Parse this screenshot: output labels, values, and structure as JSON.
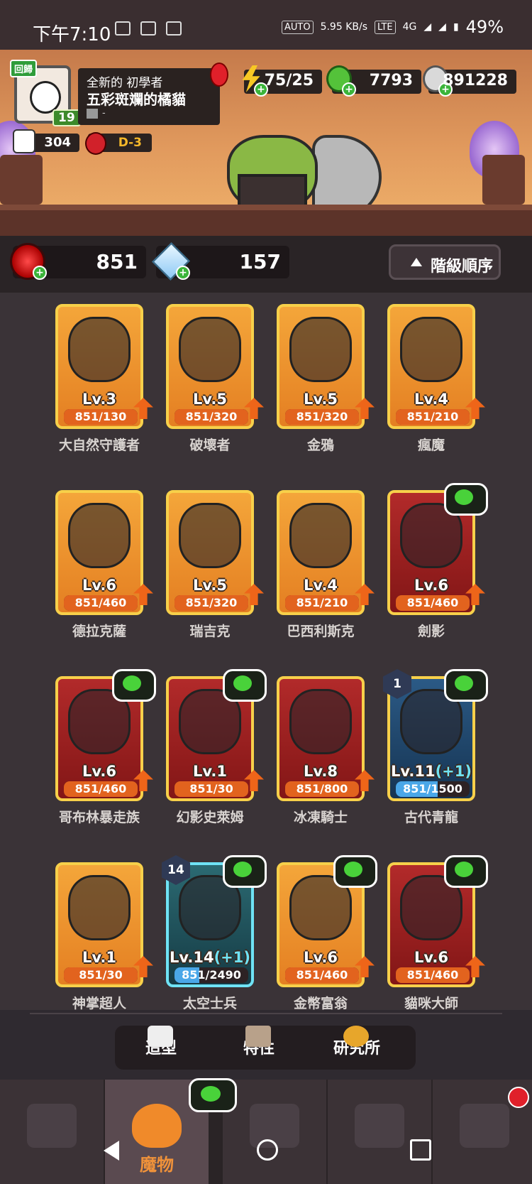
{
  "status_bar": {
    "time": "下午7:10",
    "speed": "5.95\nKB/s",
    "network": "4G",
    "battery": "49%"
  },
  "profile": {
    "return_badge": "回歸",
    "level": "19",
    "rank": "全新的 初學者",
    "name": "五彩斑斕的橘貓",
    "guild": "-",
    "likes": "304",
    "stage": "D-3"
  },
  "resources": {
    "energy": "75/25",
    "gems": "7793",
    "coins": "891228"
  },
  "currencies": {
    "red_orb": "851",
    "crystal": "157"
  },
  "sort_button": "階級順序",
  "monsters": [
    {
      "name": "大自然守護者",
      "level": "Lv.3",
      "level_plus": "",
      "progress": "851/130",
      "fill": 1.0,
      "style": "orange",
      "gem": false,
      "hex": ""
    },
    {
      "name": "破壞者",
      "level": "Lv.5",
      "level_plus": "",
      "progress": "851/320",
      "fill": 1.0,
      "style": "orange",
      "gem": false,
      "hex": ""
    },
    {
      "name": "金鴉",
      "level": "Lv.5",
      "level_plus": "",
      "progress": "851/320",
      "fill": 1.0,
      "style": "orange",
      "gem": false,
      "hex": ""
    },
    {
      "name": "瘋魔",
      "level": "Lv.4",
      "level_plus": "",
      "progress": "851/210",
      "fill": 1.0,
      "style": "orange",
      "gem": false,
      "hex": ""
    },
    {
      "name": "德拉克薩",
      "level": "Lv.6",
      "level_plus": "",
      "progress": "851/460",
      "fill": 1.0,
      "style": "orange",
      "gem": false,
      "hex": ""
    },
    {
      "name": "瑞吉克",
      "level": "Lv.5",
      "level_plus": "",
      "progress": "851/320",
      "fill": 1.0,
      "style": "orange",
      "gem": false,
      "hex": ""
    },
    {
      "name": "巴西利斯克",
      "level": "Lv.4",
      "level_plus": "",
      "progress": "851/210",
      "fill": 1.0,
      "style": "orange",
      "gem": false,
      "hex": ""
    },
    {
      "name": "劍影",
      "level": "Lv.6",
      "level_plus": "",
      "progress": "851/460",
      "fill": 1.0,
      "style": "red",
      "gem": true,
      "hex": ""
    },
    {
      "name": "哥布林暴走族",
      "level": "Lv.6",
      "level_plus": "",
      "progress": "851/460",
      "fill": 1.0,
      "style": "red",
      "gem": true,
      "hex": ""
    },
    {
      "name": "幻影史萊姆",
      "level": "Lv.1",
      "level_plus": "",
      "progress": "851/30",
      "fill": 1.0,
      "style": "red",
      "gem": true,
      "hex": ""
    },
    {
      "name": "冰凍騎士",
      "level": "Lv.8",
      "level_plus": "",
      "progress": "851/800",
      "fill": 1.0,
      "style": "red",
      "gem": false,
      "hex": ""
    },
    {
      "name": "古代青龍",
      "level": "Lv.11",
      "level_plus": "(+1)",
      "progress": "851/1500",
      "fill": 0.57,
      "style": "blue",
      "gem": true,
      "hex": "1"
    },
    {
      "name": "神掌超人",
      "level": "Lv.1",
      "level_plus": "",
      "progress": "851/30",
      "fill": 1.0,
      "style": "orange",
      "gem": false,
      "hex": ""
    },
    {
      "name": "太空士兵",
      "level": "Lv.14",
      "level_plus": "(+1)",
      "progress": "851/2490",
      "fill": 0.34,
      "style": "cyan",
      "gem": true,
      "hex": "14"
    },
    {
      "name": "金幣富翁",
      "level": "Lv.6",
      "level_plus": "",
      "progress": "851/460",
      "fill": 1.0,
      "style": "orange",
      "gem": true,
      "hex": ""
    },
    {
      "name": "貓咪大師",
      "level": "Lv.6",
      "level_plus": "",
      "progress": "851/460",
      "fill": 1.0,
      "style": "red",
      "gem": true,
      "hex": ""
    }
  ],
  "sub_tabs": [
    "造型",
    "特性",
    "研究所"
  ],
  "bottom_nav": {
    "active_label": "魔物"
  }
}
